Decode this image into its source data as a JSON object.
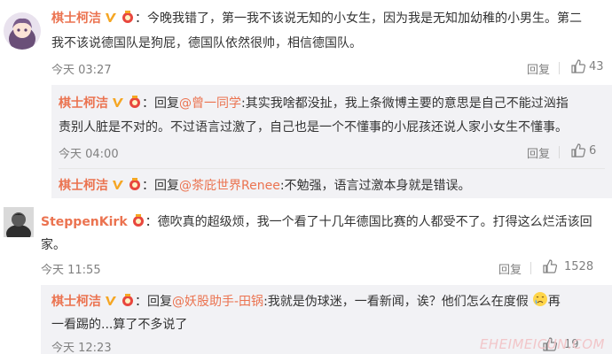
{
  "comments": [
    {
      "user": "棋士柯洁",
      "line1": "：今晚我错了，第一我不该说无知的小女生，因为我是无知加幼稚的小男生。第二",
      "line2": "我不该说德国队是狗屁，德国队依然很帅，相信德国队。",
      "time": "今天 03:27",
      "reply": "回复",
      "likes": "43"
    },
    {
      "user": "棋士柯洁",
      "prefix": "：回复",
      "mention": "@曾一同学",
      "line1": ":其实我啥都没扯，我上条微博主要的意思是自己不能过汹指",
      "line2": "责别人脏是不对的。不过语言过激了，自己也是一个不懂事的小屁孩还说人家小女生不懂事。",
      "time": "今天 04:00",
      "reply": "回复",
      "likes": "6"
    },
    {
      "user": "棋士柯洁",
      "prefix": "：回复",
      "mention": "@茶庇世界Renee",
      "line1": ":不勉强，语言过激本身就是错误。"
    },
    {
      "user": "SteppenKirk",
      "line1": "：德吹真的超级烦，我一个看了十几年德国比赛的人都受不了。打得这么烂活该回",
      "line2": "家。",
      "time": "今天 11:55",
      "reply": "回复",
      "likes": "1528"
    },
    {
      "user": "棋士柯洁",
      "prefix": "：回复",
      "mention": "@妖股助手-田锅",
      "line1": ":我就是伪球迷，一看新闻，诶？他们怎么在度假",
      "line1b": "再",
      "line2": "一看踢的...算了不多说了",
      "time": "今天 12:23",
      "likes": "19"
    }
  ],
  "watermark": "EHEIMEICUN.COM",
  "colors": {
    "name": "#eb7350",
    "text": "#333333",
    "meta": "#808080",
    "box": "#f2f2f5"
  },
  "icons": [
    "verified-v-icon",
    "medal-icon",
    "thumb-up-icon",
    "crying-emoji-icon"
  ]
}
